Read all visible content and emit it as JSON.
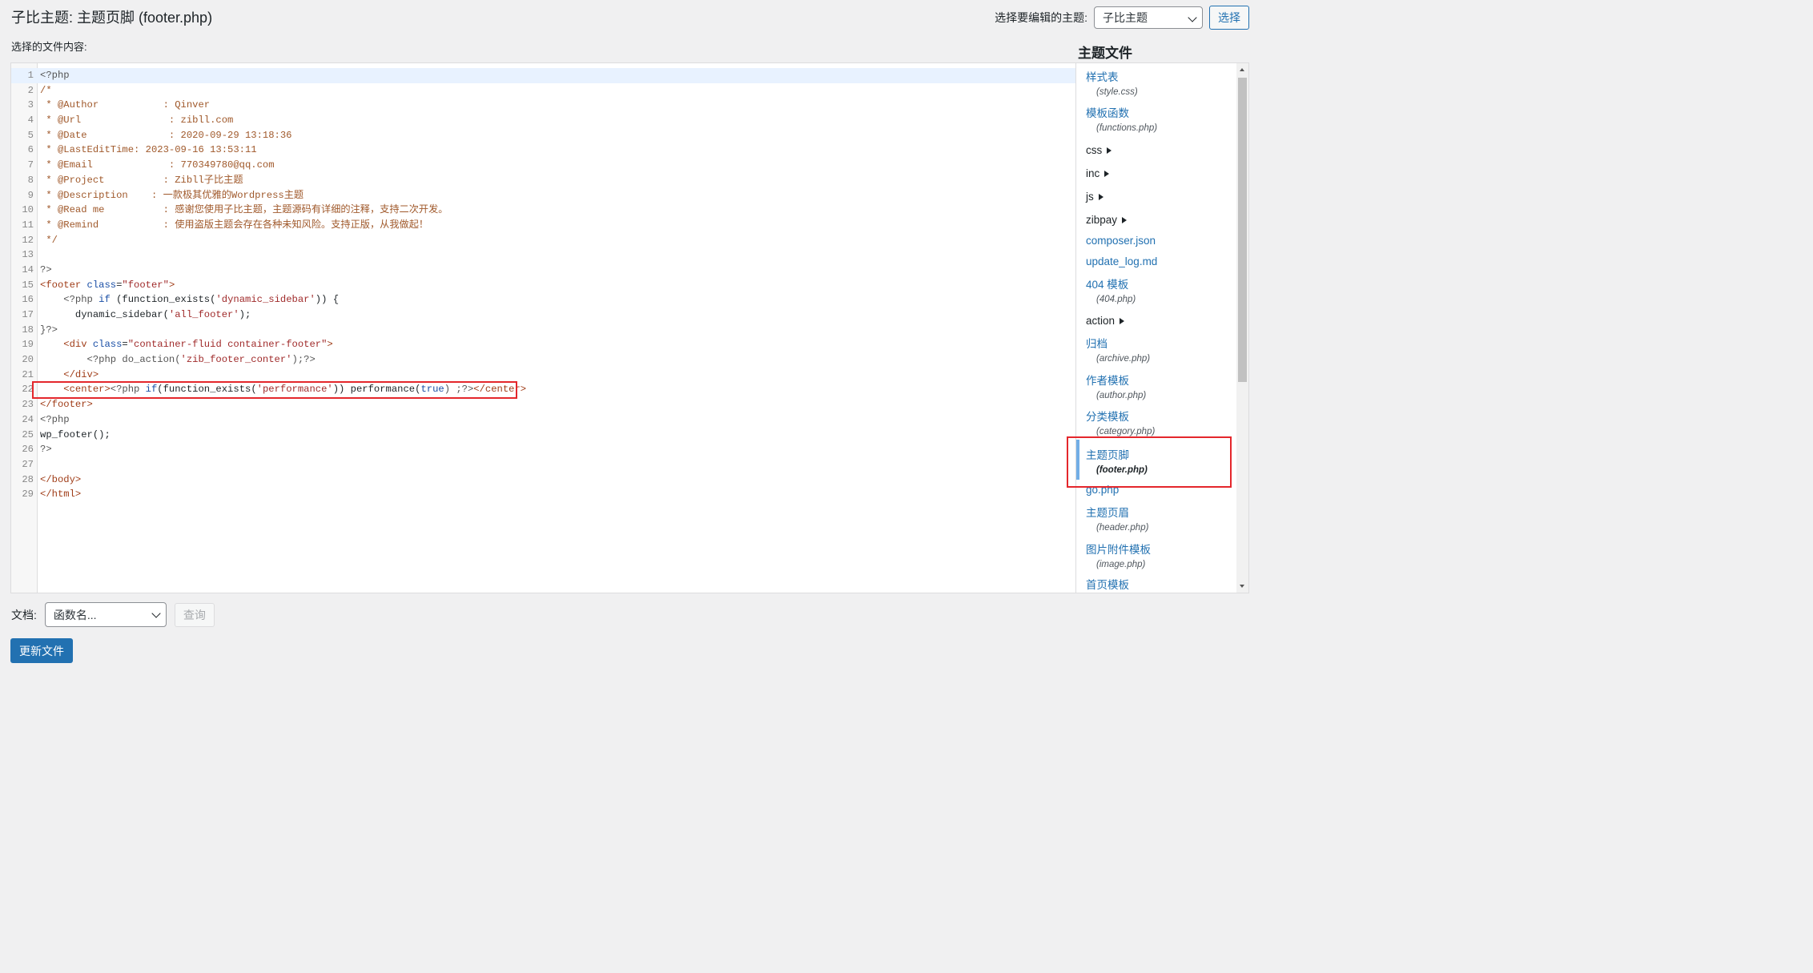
{
  "header": {
    "title": "子比主题: 主题页脚 (footer.php)",
    "theme_select_label": "选择要编辑的主题:",
    "theme_select_value": "子比主题",
    "select_button": "选择"
  },
  "editor": {
    "content_label": "选择的文件内容:",
    "line_numbers": [
      "1",
      "2",
      "3",
      "4",
      "5",
      "6",
      "7",
      "8",
      "9",
      "10",
      "11",
      "12",
      "13",
      "14",
      "15",
      "16",
      "17",
      "18",
      "19",
      "20",
      "21",
      "22",
      "23",
      "24",
      "25",
      "26",
      "27",
      "28",
      "29"
    ],
    "lines": {
      "l1": "<?php",
      "l2": "/*",
      "l3": " * @Author           : Qinver",
      "l4": " * @Url               : zibll.com",
      "l5": " * @Date              : 2020-09-29 13:18:36",
      "l6": " * @LastEditTime: 2023-09-16 13:53:11",
      "l7": " * @Email             : 770349780@qq.com",
      "l8": " * @Project          : Zibll子比主题",
      "l9": " * @Description    : 一款极其优雅的Wordpress主题",
      "l10": " * @Read me          : 感谢您使用子比主题，主题源码有详细的注释，支持二次开发。",
      "l11": " * @Remind           : 使用盗版主题会存在各种未知风险。支持正版，从我做起！",
      "l12": " */",
      "l14": "?>",
      "l15_a": "<footer ",
      "l15_b": "class",
      "l15_c": "=",
      "l15_d": "\"footer\"",
      "l15_e": ">",
      "l16_a": "    <?php ",
      "l16_b": "if",
      "l16_c": " (function_exists(",
      "l16_d": "'dynamic_sidebar'",
      "l16_e": ")) {",
      "l17_a": "      dynamic_sidebar(",
      "l17_b": "'all_footer'",
      "l17_c": ");",
      "l18": "}?>",
      "l19_a": "    <div ",
      "l19_b": "class",
      "l19_c": "=",
      "l19_d": "\"container-fluid container-footer\"",
      "l19_e": ">",
      "l20_a": "        <?php do_action(",
      "l20_b": "'zib_footer_conter'",
      "l20_c": ");?>",
      "l21": "    </div>",
      "l22_a": "    <center>",
      "l22_b": "<?php ",
      "l22_c": "if",
      "l22_d": "(function_exists(",
      "l22_e": "'performance'",
      "l22_f": ")) performance(",
      "l22_g": "true",
      "l22_h": ") ;?>",
      "l22_i": "</center>",
      "l23": "</footer>",
      "l24": "<?php",
      "l25": "wp_footer();",
      "l26": "?>",
      "l28": "</body>",
      "l29": "</html>"
    }
  },
  "file_list": {
    "heading": "主题文件",
    "entries": {
      "style": {
        "label": "样式表",
        "file": "(style.css)"
      },
      "functions": {
        "label": "模板函数",
        "file": "(functions.php)"
      },
      "css": {
        "label": "css"
      },
      "inc": {
        "label": "inc"
      },
      "js": {
        "label": "js"
      },
      "zibpay": {
        "label": "zibpay"
      },
      "composer": {
        "label": "composer.json"
      },
      "update_log": {
        "label": "update_log.md"
      },
      "e404": {
        "label": "404 模板",
        "file": "(404.php)"
      },
      "action": {
        "label": "action"
      },
      "archive": {
        "label": "归档",
        "file": "(archive.php)"
      },
      "author": {
        "label": "作者模板",
        "file": "(author.php)"
      },
      "category": {
        "label": "分类模板",
        "file": "(category.php)"
      },
      "footer": {
        "label": "主题页脚",
        "file": "(footer.php)"
      },
      "go": {
        "label": "go.php"
      },
      "header": {
        "label": "主题页眉",
        "file": "(header.php)"
      },
      "image": {
        "label": "图片附件模板",
        "file": "(image.php)"
      },
      "home": {
        "label": "首页模板"
      }
    }
  },
  "footer": {
    "doc_label": "文档:",
    "func_select_value": "函数名...",
    "query_button": "查询",
    "update_button": "更新文件"
  },
  "colors": {
    "primary": "#2271b1",
    "highlight_border": "#e4272c",
    "background": "#f0f0f1"
  }
}
